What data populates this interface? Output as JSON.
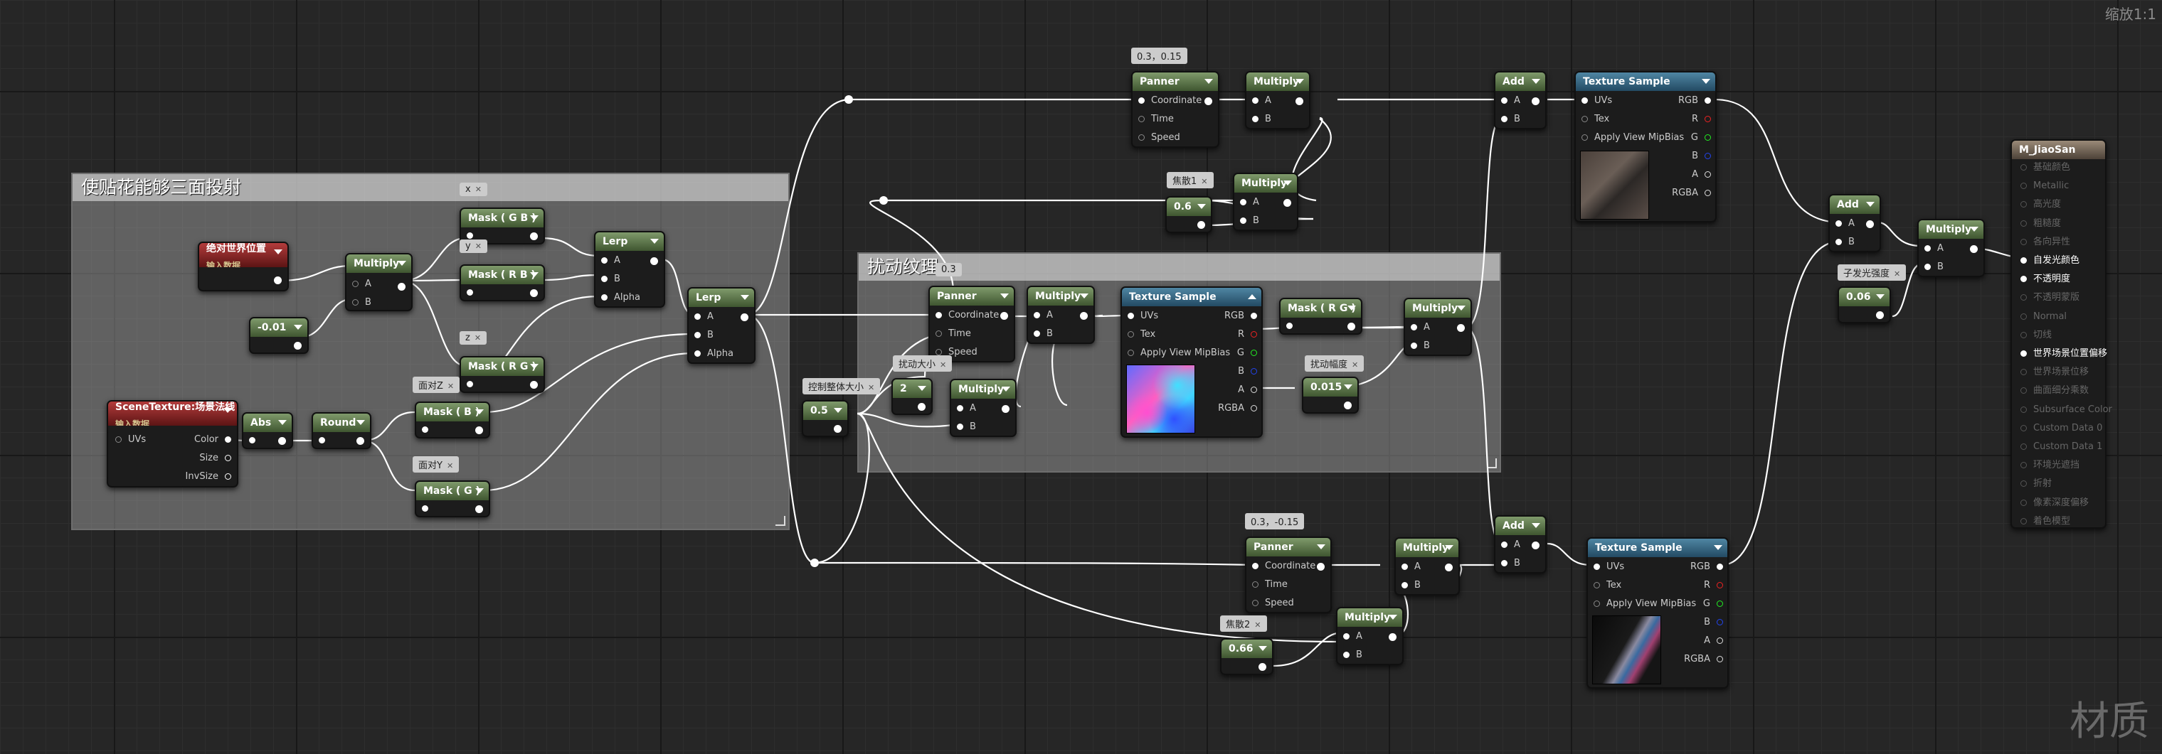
{
  "zoom_label": "缩放1:1",
  "watermark": "材质",
  "comments": {
    "triplanar": "使贴花能够三面投射",
    "distortion": "扰动纹理"
  },
  "nodes": {
    "abs_world_pos": {
      "title": "绝对世界位置",
      "subtitle": "输入数据"
    },
    "neg001": {
      "value": "-0.01"
    },
    "multiply1": {
      "title": "Multiply",
      "pin_a": "A",
      "pin_b": "B"
    },
    "mask_gb": {
      "title": "Mask ( G B )"
    },
    "mask_rb": {
      "title": "Mask ( R B )"
    },
    "mask_rg1": {
      "title": "Mask ( R G )"
    },
    "lerp1": {
      "title": "Lerp",
      "pin_a": "A",
      "pin_b": "B",
      "pin_alpha": "Alpha"
    },
    "lerp2": {
      "title": "Lerp",
      "pin_a": "A",
      "pin_b": "B",
      "pin_alpha": "Alpha"
    },
    "scene_texture": {
      "title": "SceneTexture:场景法线",
      "subtitle": "输入数据",
      "pin_uvs": "UVs",
      "pin_color": "Color",
      "pin_size": "Size",
      "pin_invsize": "InvSize"
    },
    "abs": {
      "title": "Abs"
    },
    "round": {
      "title": "Round"
    },
    "mask_b": {
      "title": "Mask ( B )"
    },
    "mask_g": {
      "title": "Mask ( G )"
    },
    "panner_top": {
      "title": "Panner",
      "pin_coord": "Coordinate",
      "pin_time": "Time",
      "pin_speed": "Speed"
    },
    "mult_top": {
      "title": "Multiply",
      "pin_a": "A",
      "pin_b": "B"
    },
    "add_top": {
      "title": "Add",
      "pin_a": "A",
      "pin_b": "B"
    },
    "tex_top": {
      "title": "Texture Sample",
      "pin_uvs": "UVs",
      "pin_tex": "Tex",
      "pin_mip": "Apply View MipBias",
      "pin_rgb": "RGB",
      "pin_r": "R",
      "pin_g": "G",
      "pin_b": "B",
      "pin_a": "A",
      "pin_rgba": "RGBA"
    },
    "scale1": {
      "value": "0.6"
    },
    "mult_scale1": {
      "title": "Multiply",
      "pin_a": "A",
      "pin_b": "B"
    },
    "panner_mid": {
      "title": "Panner",
      "pin_coord": "Coordinate",
      "pin_time": "Time",
      "pin_speed": "Speed"
    },
    "mult_mid": {
      "title": "Multiply",
      "pin_a": "A",
      "pin_b": "B"
    },
    "tex_mid": {
      "title": "Texture Sample",
      "pin_uvs": "UVs",
      "pin_tex": "Tex",
      "pin_mip": "Apply View MipBias",
      "pin_rgb": "RGB",
      "pin_r": "R",
      "pin_g": "G",
      "pin_b": "B",
      "pin_a": "A",
      "pin_rgba": "RGBA"
    },
    "mask_rg2": {
      "title": "Mask ( R G )"
    },
    "mult_dist": {
      "title": "Multiply",
      "pin_a": "A",
      "pin_b": "B"
    },
    "dist_amount": {
      "value": "0.015"
    },
    "dist_size": {
      "value": "2"
    },
    "mult_size": {
      "title": "Multiply",
      "pin_a": "A",
      "pin_b": "B"
    },
    "overall_size": {
      "value": "0.5"
    },
    "panner_bot": {
      "title": "Panner",
      "pin_coord": "Coordinate",
      "pin_time": "Time",
      "pin_speed": "Speed"
    },
    "mult_bot": {
      "title": "Multiply",
      "pin_a": "A",
      "pin_b": "B"
    },
    "add_bot": {
      "title": "Add",
      "pin_a": "A",
      "pin_b": "B"
    },
    "tex_bot": {
      "title": "Texture Sample",
      "pin_uvs": "UVs",
      "pin_tex": "Tex",
      "pin_mip": "Apply View MipBias",
      "pin_rgb": "RGB",
      "pin_r": "R",
      "pin_g": "G",
      "pin_b": "B",
      "pin_a": "A",
      "pin_rgba": "RGBA"
    },
    "scale2": {
      "value": "0.66"
    },
    "mult_scale2": {
      "title": "Multiply",
      "pin_a": "A",
      "pin_b": "B"
    },
    "add_final": {
      "title": "Add",
      "pin_a": "A",
      "pin_b": "B"
    },
    "mult_final": {
      "title": "Multiply",
      "pin_a": "A",
      "pin_b": "B"
    },
    "emissive_strength": {
      "value": "0.06"
    }
  },
  "labels": {
    "speed_top": "0.3，0.15",
    "x": "x",
    "y": "y",
    "z": "z",
    "face_z": "面对Z",
    "face_y": "面对Y",
    "scale1": "焦散1",
    "speed_mid": "0.3",
    "dist_size": "扰动大小",
    "overall_size": "控制整体大小",
    "dist_amount": "扰动幅度",
    "speed_bot": "0.3，-0.15",
    "scale2": "焦散2",
    "emissive_strength": "子发光强度"
  },
  "result_node": {
    "title": "M_JiaoSan",
    "pins": [
      {
        "label": "基础颜色",
        "active": false
      },
      {
        "label": "Metallic",
        "active": false
      },
      {
        "label": "高光度",
        "active": false
      },
      {
        "label": "粗糙度",
        "active": false
      },
      {
        "label": "各向异性",
        "active": false
      },
      {
        "label": "自发光颜色",
        "active": true
      },
      {
        "label": "不透明度",
        "active": true
      },
      {
        "label": "不透明蒙版",
        "active": false
      },
      {
        "label": "Normal",
        "active": false
      },
      {
        "label": "切线",
        "active": false
      },
      {
        "label": "世界场景位置偏移",
        "active": true
      },
      {
        "label": "世界场景位移",
        "active": false
      },
      {
        "label": "曲面细分乘数",
        "active": false
      },
      {
        "label": "Subsurface Color",
        "active": false
      },
      {
        "label": "Custom Data 0",
        "active": false
      },
      {
        "label": "Custom Data 1",
        "active": false
      },
      {
        "label": "环境光遮挡",
        "active": false
      },
      {
        "label": "折射",
        "active": false
      },
      {
        "label": "像素深度偏移",
        "active": false
      },
      {
        "label": "着色模型",
        "active": false
      }
    ]
  },
  "colors": {
    "background": "#262626",
    "node_body": "#1c1c1c",
    "header_green": "#5d7a4a",
    "header_blue": "#2f6a8a",
    "header_red": "#8a2020",
    "header_result": "#7a6a58",
    "value_green": "#7fc240",
    "wire": "#ffffff"
  }
}
